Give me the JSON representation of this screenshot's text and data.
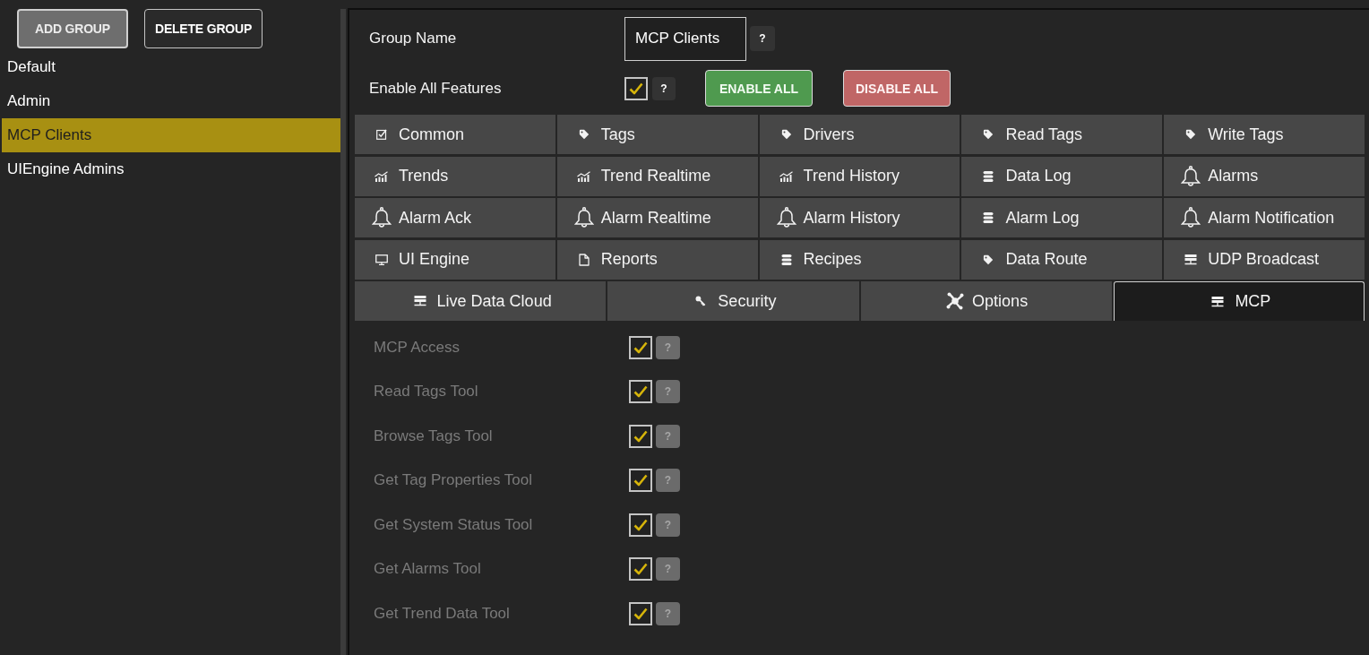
{
  "sidebar": {
    "buttons": [
      {
        "label": "ADD GROUP",
        "disabled": true
      },
      {
        "label": "DELETE GROUP",
        "disabled": false
      }
    ],
    "groups": [
      {
        "label": "Default",
        "selected": false
      },
      {
        "label": "Admin",
        "selected": false
      },
      {
        "label": "MCP Clients",
        "selected": true
      },
      {
        "label": "UIEngine Admins",
        "selected": false
      }
    ]
  },
  "group_form": {
    "group_name": {
      "label": "Group Name",
      "value": "MCP Clients",
      "help": "?"
    },
    "enable_all": {
      "label": "Enable All Features",
      "checked": true,
      "help": "?"
    },
    "buttons": [
      {
        "label": "ENABLE ALL",
        "kind": "enable",
        "disabled": true
      },
      {
        "label": "DISABLE ALL",
        "kind": "disable",
        "disabled": true
      }
    ]
  },
  "feature_tab_rows": [
    {
      "tabs": [
        {
          "label": "Common",
          "selected": false
        },
        {
          "label": "Tags",
          "selected": false
        },
        {
          "label": "Drivers",
          "selected": false
        },
        {
          "label": "Read Tags",
          "selected": false
        },
        {
          "label": "Write Tags",
          "selected": false
        }
      ]
    },
    {
      "tabs": [
        {
          "label": "Trends",
          "selected": false
        },
        {
          "label": "Trend Realtime",
          "selected": false
        },
        {
          "label": "Trend History",
          "selected": false
        },
        {
          "label": "Data Log",
          "selected": false
        },
        {
          "label": "Alarms",
          "selected": false
        }
      ]
    },
    {
      "tabs": [
        {
          "label": "Alarm Ack",
          "selected": false
        },
        {
          "label": "Alarm Realtime",
          "selected": false
        },
        {
          "label": "Alarm History",
          "selected": false
        },
        {
          "label": "Alarm Log",
          "selected": false
        },
        {
          "label": "Alarm Notification",
          "selected": false
        }
      ]
    },
    {
      "tabs": [
        {
          "label": "UI Engine",
          "selected": false
        },
        {
          "label": "Reports",
          "selected": false
        },
        {
          "label": "Recipes",
          "selected": false
        },
        {
          "label": "Data Route",
          "selected": false
        },
        {
          "label": "UDP Broadcast",
          "selected": false
        }
      ]
    },
    {
      "tabs": [
        {
          "label": "Live Data Cloud",
          "selected": false
        },
        {
          "label": "Security",
          "selected": false
        },
        {
          "label": "Options",
          "selected": false
        },
        {
          "label": "MCP",
          "selected": true
        }
      ]
    }
  ],
  "mcp_settings": [
    {
      "label": "MCP Access",
      "checked": true,
      "disabled": true,
      "help": "?"
    },
    {
      "label": "Read Tags Tool",
      "checked": true,
      "disabled": true,
      "help": "?"
    },
    {
      "label": "Browse Tags Tool",
      "checked": true,
      "disabled": true,
      "help": "?"
    },
    {
      "label": "Get Tag Properties Tool",
      "checked": true,
      "disabled": true,
      "help": "?"
    },
    {
      "label": "Get System Status Tool",
      "checked": true,
      "disabled": true,
      "help": "?"
    },
    {
      "label": "Get Alarms Tool",
      "checked": true,
      "disabled": true,
      "help": "?"
    },
    {
      "label": "Get Trend Data Tool",
      "checked": true,
      "disabled": true,
      "help": "?"
    }
  ]
}
